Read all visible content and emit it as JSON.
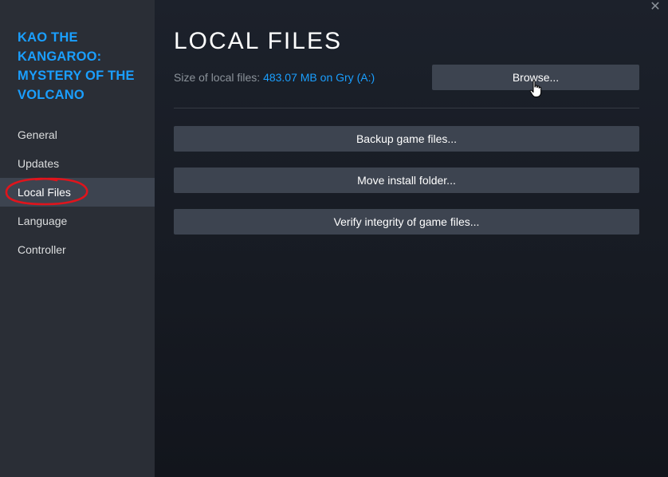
{
  "sidebar": {
    "game_title": "KAO THE KANGAROO: MYSTERY OF THE VOLCANO",
    "items": [
      {
        "label": "General"
      },
      {
        "label": "Updates"
      },
      {
        "label": "Local Files",
        "active": true
      },
      {
        "label": "Language"
      },
      {
        "label": "Controller"
      }
    ]
  },
  "window": {
    "close_icon": "close-icon",
    "close_glyph": "✕"
  },
  "main": {
    "title": "LOCAL FILES",
    "size_label": "Size of local files:",
    "size_value": "483.07 MB on Gry (A:)",
    "browse_label": "Browse...",
    "buttons": [
      {
        "label": "Backup game files..."
      },
      {
        "label": "Move install folder..."
      },
      {
        "label": "Verify integrity of game files..."
      }
    ]
  },
  "colors": {
    "accent": "#1a9fff",
    "sidebar_bg": "#2a2e36",
    "active_item_bg": "#3d4450",
    "button_bg": "#3d4450",
    "annotation": "#e0141c"
  }
}
